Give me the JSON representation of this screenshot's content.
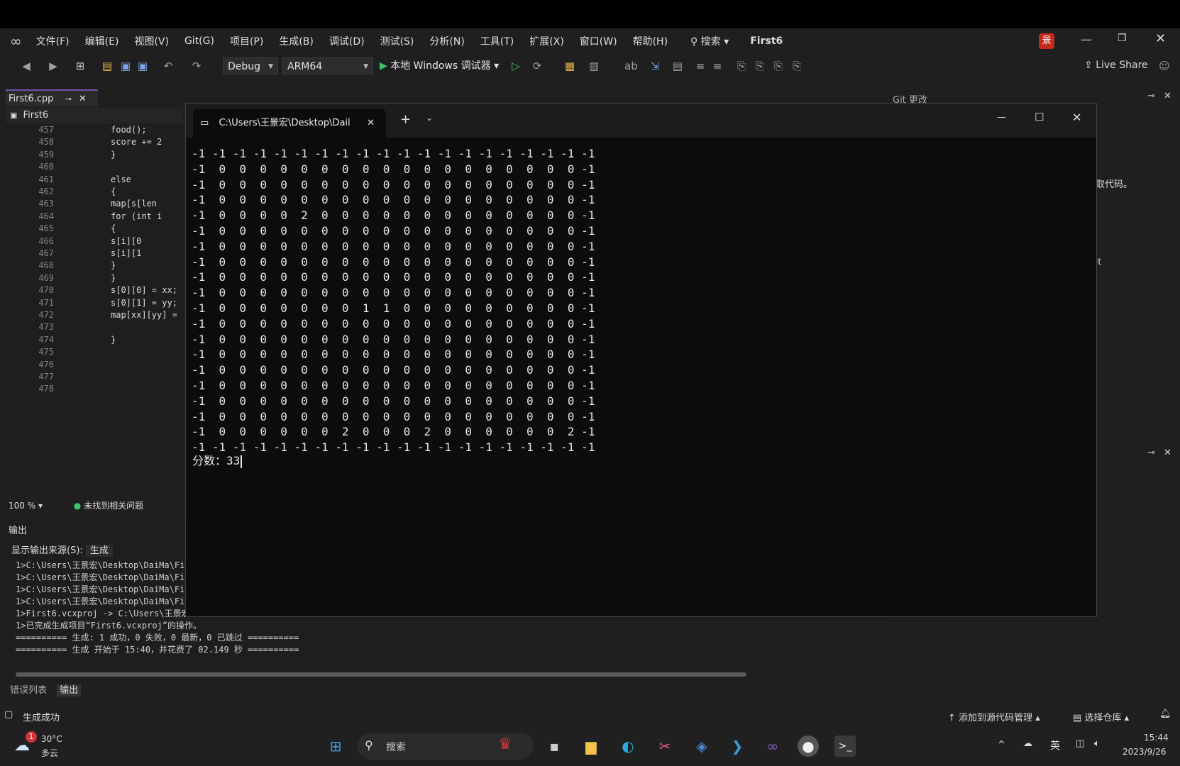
{
  "menu": [
    "文件(F)",
    "编辑(E)",
    "视图(V)",
    "Git(G)",
    "项目(P)",
    "生成(B)",
    "调试(D)",
    "测试(S)",
    "分析(N)",
    "工具(T)",
    "扩展(X)",
    "窗口(W)",
    "帮助(H)"
  ],
  "search_label": "搜索",
  "project_title": "First6",
  "toolbar": {
    "config": "Debug",
    "platform": "ARM64",
    "debugger": "本地 Windows 调试器",
    "live_share": "Live Share"
  },
  "editor": {
    "tab": "First6.cpp",
    "nav": "First6",
    "lines": [
      {
        "n": "457",
        "t": "food();"
      },
      {
        "n": "458",
        "t": "score += 2"
      },
      {
        "n": "459",
        "t": "}"
      },
      {
        "n": "460",
        "t": ""
      },
      {
        "n": "461",
        "t": "else"
      },
      {
        "n": "462",
        "t": "{"
      },
      {
        "n": "463",
        "t": "map[s[len"
      },
      {
        "n": "464",
        "t": "for (int i"
      },
      {
        "n": "465",
        "t": "{"
      },
      {
        "n": "466",
        "t": "s[i][0"
      },
      {
        "n": "467",
        "t": "s[i][1"
      },
      {
        "n": "468",
        "t": "}"
      },
      {
        "n": "469",
        "t": "}"
      },
      {
        "n": "470",
        "t": "s[0][0] = xx;"
      },
      {
        "n": "471",
        "t": "s[0][1] = yy;"
      },
      {
        "n": "472",
        "t": "map[xx][yy] ="
      },
      {
        "n": "473",
        "t": ""
      },
      {
        "n": "474",
        "t": "}"
      },
      {
        "n": "475",
        "t": ""
      },
      {
        "n": "476",
        "t": ""
      },
      {
        "n": "477",
        "t": ""
      },
      {
        "n": "478",
        "t": ""
      }
    ],
    "zoom": "100 %",
    "issues": "未找到相关问题"
  },
  "right_panel": {
    "title": "Git 更改",
    "snippet1": "取代码。",
    "snippet2": "it"
  },
  "output": {
    "title": "输出",
    "source_label": "显示输出来源(S):",
    "source_value": "生成",
    "lines": [
      "1>C:\\Users\\王景宏\\Desktop\\DaiMa\\Fi",
      "1>C:\\Users\\王景宏\\Desktop\\DaiMa\\Fi",
      "1>C:\\Users\\王景宏\\Desktop\\DaiMa\\Fi",
      "1>C:\\Users\\王景宏\\Desktop\\DaiMa\\Fi",
      "1>First6.vcxproj -> C:\\Users\\王景宏",
      "1>已完成生成项目“First6.vcxproj”的操作。",
      "========== 生成: 1 成功，0 失败，0 最新，0 已跳过 ==========",
      "========== 生成 开始于 15:40，并花费了 02.149 秒 =========="
    ]
  },
  "bottom_tabs": [
    "错误列表",
    "输出"
  ],
  "status": {
    "left": "生成成功",
    "source_control": "添加到源代码管理",
    "repo": "选择仓库"
  },
  "terminal": {
    "tab_title": "C:\\Users\\王景宏\\Desktop\\Dail",
    "rows": [
      "-1 -1 -1 -1 -1 -1 -1 -1 -1 -1 -1 -1 -1 -1 -1 -1 -1 -1 -1 -1",
      "-1  0  0  0  0  0  0  0  0  0  0  0  0  0  0  0  0  0  0 -1",
      "-1  0  0  0  0  0  0  0  0  0  0  0  0  0  0  0  0  0  0 -1",
      "-1  0  0  0  0  0  0  0  0  0  0  0  0  0  0  0  0  0  0 -1",
      "-1  0  0  0  0  2  0  0  0  0  0  0  0  0  0  0  0  0  0 -1",
      "-1  0  0  0  0  0  0  0  0  0  0  0  0  0  0  0  0  0  0 -1",
      "-1  0  0  0  0  0  0  0  0  0  0  0  0  0  0  0  0  0  0 -1",
      "-1  0  0  0  0  0  0  0  0  0  0  0  0  0  0  0  0  0  0 -1",
      "-1  0  0  0  0  0  0  0  0  0  0  0  0  0  0  0  0  0  0 -1",
      "-1  0  0  0  0  0  0  0  0  0  0  0  0  0  0  0  0  0  0 -1",
      "-1  0  0  0  0  0  0  0  1  1  0  0  0  0  0  0  0  0  0 -1",
      "-1  0  0  0  0  0  0  0  0  0  0  0  0  0  0  0  0  0  0 -1",
      "-1  0  0  0  0  0  0  0  0  0  0  0  0  0  0  0  0  0  0 -1",
      "-1  0  0  0  0  0  0  0  0  0  0  0  0  0  0  0  0  0  0 -1",
      "-1  0  0  0  0  0  0  0  0  0  0  0  0  0  0  0  0  0  0 -1",
      "-1  0  0  0  0  0  0  0  0  0  0  0  0  0  0  0  0  0  0 -1",
      "-1  0  0  0  0  0  0  0  0  0  0  0  0  0  0  0  0  0  0 -1",
      "-1  0  0  0  0  0  0  0  0  0  0  0  0  0  0  0  0  0  0 -1",
      "-1  0  0  0  0  0  0  2  0  0  0  2  0  0  0  0  0  0  2 -1",
      "-1 -1 -1 -1 -1 -1 -1 -1 -1 -1 -1 -1 -1 -1 -1 -1 -1 -1 -1 -1"
    ],
    "score_label": "分数：",
    "score_value": "33"
  },
  "taskbar": {
    "weather_temp": "30°C",
    "weather_desc": "多云",
    "weather_badge": "1",
    "search": "搜索",
    "ime": "英",
    "time": "15:44",
    "date": "2023/9/26"
  },
  "icons": [
    "vs-logo-icon",
    "play-icon",
    "search-icon",
    "windows-start-icon",
    "file-explorer-icon",
    "edge-icon",
    "vscode-icon",
    "visual-studio-icon",
    "terminal-icon",
    "wifi-icon",
    "volume-icon",
    "cloud-icon",
    "bell-icon"
  ],
  "colors": {
    "accent": "#6f4fb0",
    "play": "#3ec46d",
    "vs_purple": "#8661c5",
    "terminal_bg": "#0c0c0c"
  }
}
